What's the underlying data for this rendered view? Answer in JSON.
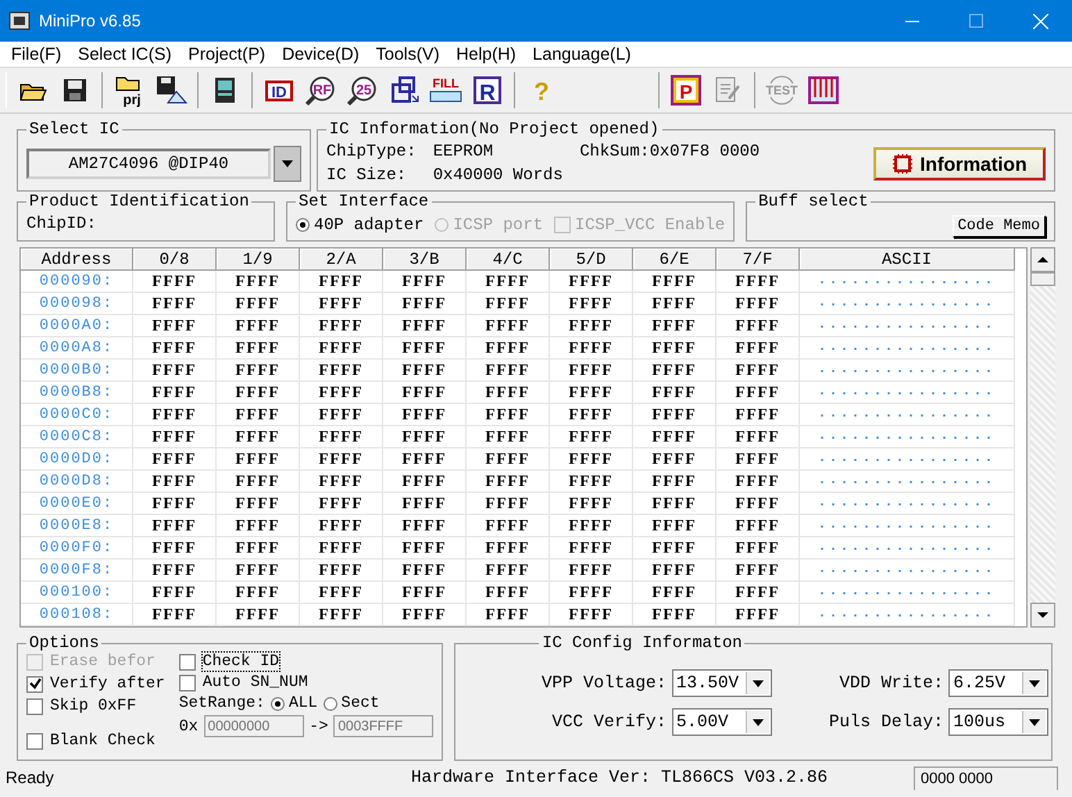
{
  "window": {
    "title": "MiniPro v6.85"
  },
  "menu": [
    "File(F)",
    "Select IC(S)",
    "Project(P)",
    "Device(D)",
    "Tools(V)",
    "Help(H)",
    "Language(L)"
  ],
  "toolbar": [
    {
      "items": [
        {
          "kind": "open",
          "disabled": false
        },
        {
          "kind": "save",
          "disabled": false
        }
      ]
    },
    {
      "items": [
        {
          "kind": "project",
          "label": "prj",
          "disabled": false
        },
        {
          "kind": "save-image",
          "disabled": false
        }
      ]
    },
    {
      "items": [
        {
          "kind": "chip",
          "disabled": false
        }
      ]
    },
    {
      "items": [
        {
          "kind": "chip-label",
          "label": "ID",
          "disabled": false
        },
        {
          "kind": "lens",
          "label": "RF",
          "disabled": false
        },
        {
          "kind": "lens",
          "label": "25",
          "disabled": false
        },
        {
          "kind": "move",
          "disabled": false
        },
        {
          "kind": "fill",
          "label": "FILL",
          "disabled": false
        },
        {
          "kind": "letter",
          "label": "R",
          "disabled": false
        }
      ]
    },
    {
      "items": [
        {
          "kind": "help",
          "label": "?",
          "disabled": false
        }
      ]
    },
    {
      "items": [
        {
          "kind": "letter-red",
          "label": "P",
          "disabled": false
        },
        {
          "kind": "edit",
          "disabled": true
        }
      ]
    },
    {
      "items": [
        {
          "kind": "test",
          "label": "TEST",
          "disabled": true
        },
        {
          "kind": "pins",
          "disabled": false
        }
      ]
    }
  ],
  "select_ic": {
    "label": "Select IC",
    "value": "AM27C4096   @DIP40"
  },
  "ic_information": {
    "label": "IC Information(No Project opened)",
    "chip_type_label": "ChipType:",
    "chip_type": "EEPROM",
    "checksum": "ChkSum:0x07F8 0000",
    "ic_size_label": "IC Size:",
    "ic_size": "0x40000 Words",
    "button": "Information"
  },
  "product_identification": {
    "label": "Product Identification",
    "chip_id_label": "ChipID:"
  },
  "set_interface": {
    "label": "Set Interface",
    "options": [
      {
        "kind": "radio",
        "label": "40P adapter",
        "selected": true,
        "disabled": false
      },
      {
        "kind": "radio",
        "label": "ICSP port",
        "selected": false,
        "disabled": true
      },
      {
        "kind": "checkbox",
        "label": "ICSP_VCC Enable",
        "checked": false,
        "disabled": true
      }
    ]
  },
  "buff_select": {
    "label": "Buff select",
    "button": "Code Memo"
  },
  "table": {
    "columns": [
      "Address",
      "0/8",
      "1/9",
      "2/A",
      "3/B",
      "4/C",
      "5/D",
      "6/E",
      "7/F",
      "ASCII"
    ],
    "rows": [
      {
        "cells": [
          "000090:",
          "FFFF",
          "FFFF",
          "FFFF",
          "FFFF",
          "FFFF",
          "FFFF",
          "FFFF",
          "FFFF",
          "................"
        ]
      },
      {
        "cells": [
          "000098:",
          "FFFF",
          "FFFF",
          "FFFF",
          "FFFF",
          "FFFF",
          "FFFF",
          "FFFF",
          "FFFF",
          "................"
        ]
      },
      {
        "cells": [
          "0000A0:",
          "FFFF",
          "FFFF",
          "FFFF",
          "FFFF",
          "FFFF",
          "FFFF",
          "FFFF",
          "FFFF",
          "................"
        ]
      },
      {
        "cells": [
          "0000A8:",
          "FFFF",
          "FFFF",
          "FFFF",
          "FFFF",
          "FFFF",
          "FFFF",
          "FFFF",
          "FFFF",
          "................"
        ]
      },
      {
        "cells": [
          "0000B0:",
          "FFFF",
          "FFFF",
          "FFFF",
          "FFFF",
          "FFFF",
          "FFFF",
          "FFFF",
          "FFFF",
          "................"
        ]
      },
      {
        "cells": [
          "0000B8:",
          "FFFF",
          "FFFF",
          "FFFF",
          "FFFF",
          "FFFF",
          "FFFF",
          "FFFF",
          "FFFF",
          "................"
        ]
      },
      {
        "cells": [
          "0000C0:",
          "FFFF",
          "FFFF",
          "FFFF",
          "FFFF",
          "FFFF",
          "FFFF",
          "FFFF",
          "FFFF",
          "................"
        ]
      },
      {
        "cells": [
          "0000C8:",
          "FFFF",
          "FFFF",
          "FFFF",
          "FFFF",
          "FFFF",
          "FFFF",
          "FFFF",
          "FFFF",
          "................"
        ]
      },
      {
        "cells": [
          "0000D0:",
          "FFFF",
          "FFFF",
          "FFFF",
          "FFFF",
          "FFFF",
          "FFFF",
          "FFFF",
          "FFFF",
          "................"
        ]
      },
      {
        "cells": [
          "0000D8:",
          "FFFF",
          "FFFF",
          "FFFF",
          "FFFF",
          "FFFF",
          "FFFF",
          "FFFF",
          "FFFF",
          "................"
        ]
      },
      {
        "cells": [
          "0000E0:",
          "FFFF",
          "FFFF",
          "FFFF",
          "FFFF",
          "FFFF",
          "FFFF",
          "FFFF",
          "FFFF",
          "................"
        ]
      },
      {
        "cells": [
          "0000E8:",
          "FFFF",
          "FFFF",
          "FFFF",
          "FFFF",
          "FFFF",
          "FFFF",
          "FFFF",
          "FFFF",
          "................"
        ]
      },
      {
        "cells": [
          "0000F0:",
          "FFFF",
          "FFFF",
          "FFFF",
          "FFFF",
          "FFFF",
          "FFFF",
          "FFFF",
          "FFFF",
          "................"
        ]
      },
      {
        "cells": [
          "0000F8:",
          "FFFF",
          "FFFF",
          "FFFF",
          "FFFF",
          "FFFF",
          "FFFF",
          "FFFF",
          "FFFF",
          "................"
        ]
      },
      {
        "cells": [
          "000100:",
          "FFFF",
          "FFFF",
          "FFFF",
          "FFFF",
          "FFFF",
          "FFFF",
          "FFFF",
          "FFFF",
          "................"
        ]
      },
      {
        "cells": [
          "000108:",
          "FFFF",
          "FFFF",
          "FFFF",
          "FFFF",
          "FFFF",
          "FFFF",
          "FFFF",
          "FFFF",
          "................"
        ]
      }
    ]
  },
  "options": {
    "label": "Options",
    "checks": [
      {
        "label": "Erase befor",
        "checked": false,
        "disabled": true
      },
      {
        "label": "Verify after",
        "checked": true,
        "disabled": false
      },
      {
        "label": "Skip 0xFF",
        "checked": false,
        "disabled": false
      },
      {
        "label": "Blank Check",
        "checked": false,
        "disabled": false
      },
      {
        "label": "Check ID",
        "checked": false,
        "disabled": false
      },
      {
        "label": "Auto SN_NUM",
        "checked": false,
        "disabled": false
      }
    ],
    "set_range": {
      "label": "SetRange:",
      "choices": [
        {
          "label": "ALL",
          "selected": true
        },
        {
          "label": "Sect",
          "selected": false
        }
      ],
      "prefix": "0x",
      "start": "00000000",
      "arrow": "->",
      "end": "0003FFFF"
    }
  },
  "ic_config": {
    "label": "IC Config Informaton",
    "fields": [
      {
        "label": "VPP Voltage:",
        "value": "13.50V"
      },
      {
        "label": "VDD Write:",
        "value": "6.25V"
      },
      {
        "label": "VCC Verify:",
        "value": "5.00V"
      },
      {
        "label": "Puls Delay:",
        "value": "100us"
      }
    ]
  },
  "status_bar": {
    "message": "Ready",
    "hardware": "Hardware Interface Ver: TL866CS V03.2.86",
    "code": "0000 0000"
  }
}
